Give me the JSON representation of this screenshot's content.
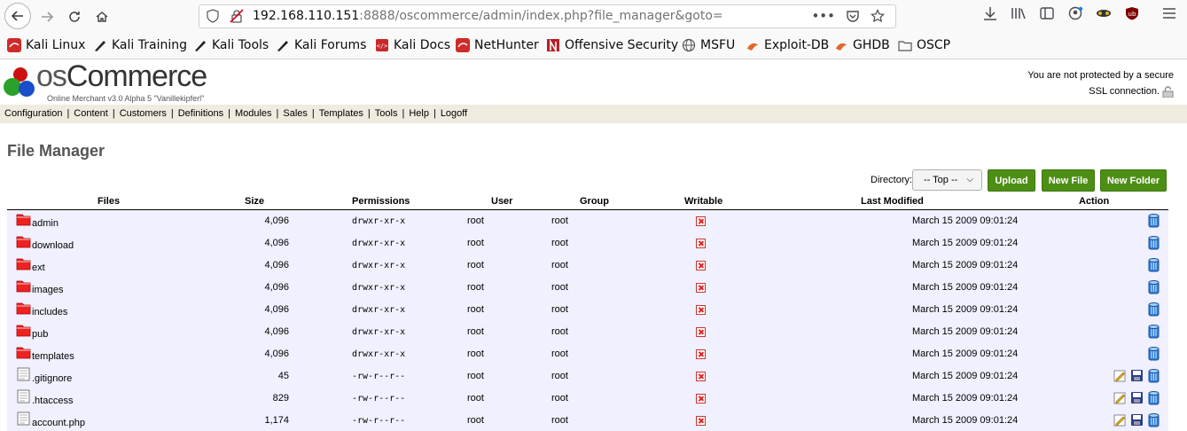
{
  "browser": {
    "url_host": "192.168.110.151",
    "url_rest": ":8888/oscommerce/admin/index.php?file_manager&goto=",
    "bookmarks": [
      "Kali Linux",
      "Kali Training",
      "Kali Tools",
      "Kali Forums",
      "Kali Docs",
      "NetHunter",
      "Offensive Security",
      "MSFU",
      "Exploit-DB",
      "GHDB",
      "OSCP"
    ]
  },
  "header": {
    "logo_os": "os",
    "logo_commerce": "Commerce",
    "logo_sub": "Online Merchant v3.0 Alpha 5 \"Vanillekipferl\"",
    "ssl_line1": "You are not protected by a secure",
    "ssl_line2": "SSL connection."
  },
  "menu": [
    "Configuration",
    "Content",
    "Customers",
    "Definitions",
    "Modules",
    "Sales",
    "Templates",
    "Tools",
    "Help",
    "Logoff"
  ],
  "page_title": "File Manager",
  "directory": {
    "label": "Directory:",
    "selected": "-- Top --"
  },
  "buttons": {
    "upload": "Upload",
    "new_file": "New File",
    "new_folder": "New Folder"
  },
  "columns": {
    "files": "Files",
    "size": "Size",
    "permissions": "Permissions",
    "user": "User",
    "group": "Group",
    "writable": "Writable",
    "last_modified": "Last Modified",
    "action": "Action"
  },
  "rows": [
    {
      "name": "admin",
      "type": "folder",
      "size": "4,096",
      "perms": "drwxr-xr-x",
      "user": "root",
      "group": "root",
      "modified": "March 15 2009 09:01:24"
    },
    {
      "name": "download",
      "type": "folder",
      "size": "4,096",
      "perms": "drwxr-xr-x",
      "user": "root",
      "group": "root",
      "modified": "March 15 2009 09:01:24"
    },
    {
      "name": "ext",
      "type": "folder",
      "size": "4,096",
      "perms": "drwxr-xr-x",
      "user": "root",
      "group": "root",
      "modified": "March 15 2009 09:01:24"
    },
    {
      "name": "images",
      "type": "folder",
      "size": "4,096",
      "perms": "drwxr-xr-x",
      "user": "root",
      "group": "root",
      "modified": "March 15 2009 09:01:24"
    },
    {
      "name": "includes",
      "type": "folder",
      "size": "4,096",
      "perms": "drwxr-xr-x",
      "user": "root",
      "group": "root",
      "modified": "March 15 2009 09:01:24"
    },
    {
      "name": "pub",
      "type": "folder",
      "size": "4,096",
      "perms": "drwxr-xr-x",
      "user": "root",
      "group": "root",
      "modified": "March 15 2009 09:01:24"
    },
    {
      "name": "templates",
      "type": "folder",
      "size": "4,096",
      "perms": "drwxr-xr-x",
      "user": "root",
      "group": "root",
      "modified": "March 15 2009 09:01:24"
    },
    {
      "name": ".gitignore",
      "type": "file",
      "size": "45",
      "perms": "-rw-r--r--",
      "user": "root",
      "group": "root",
      "modified": "March 15 2009 09:01:24"
    },
    {
      "name": ".htaccess",
      "type": "file",
      "size": "829",
      "perms": "-rw-r--r--",
      "user": "root",
      "group": "root",
      "modified": "March 15 2009 09:01:24"
    },
    {
      "name": "account.php",
      "type": "file",
      "size": "1,174",
      "perms": "-rw-r--r--",
      "user": "root",
      "group": "root",
      "modified": "March 15 2009 09:01:24"
    }
  ]
}
